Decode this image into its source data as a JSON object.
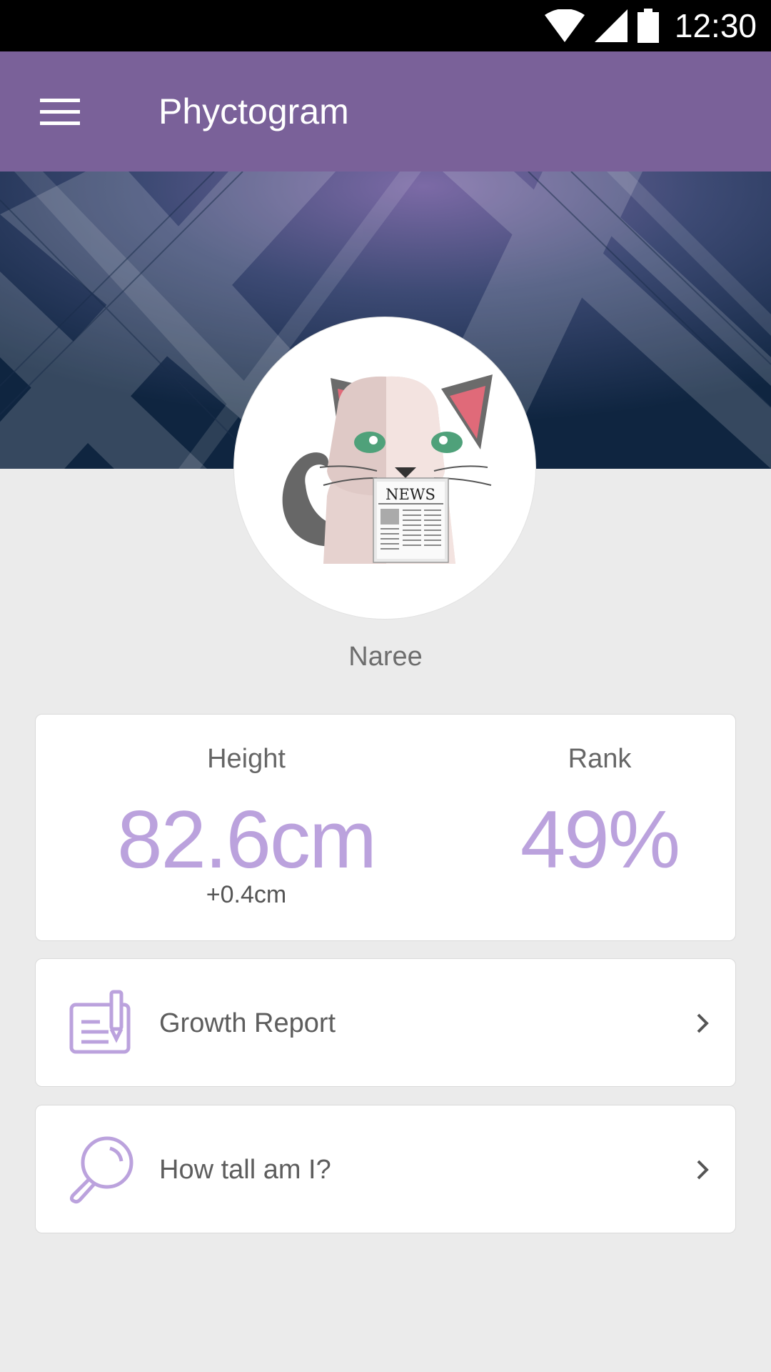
{
  "status_bar": {
    "time": "12:30",
    "icons": [
      "wifi-icon",
      "cell-signal-icon",
      "battery-icon"
    ]
  },
  "app_bar": {
    "title": "Phyctogram",
    "menu_icon": "hamburger-menu-icon"
  },
  "profile": {
    "name": "Naree",
    "avatar_icon": "cat-reading-newspaper",
    "avatar_text": "NEWS"
  },
  "stats": {
    "height_label": "Height",
    "height_value": "82.6cm",
    "height_delta": "+0.4cm",
    "rank_label": "Rank",
    "rank_value": "49%"
  },
  "menu": [
    {
      "label": "Growth Report",
      "icon": "report-pen-icon"
    },
    {
      "label": "How tall am I?",
      "icon": "magnifier-icon"
    }
  ],
  "colors": {
    "app_bar": "#7a6199",
    "accent": "#bba2dd",
    "background": "#ebebeb"
  }
}
